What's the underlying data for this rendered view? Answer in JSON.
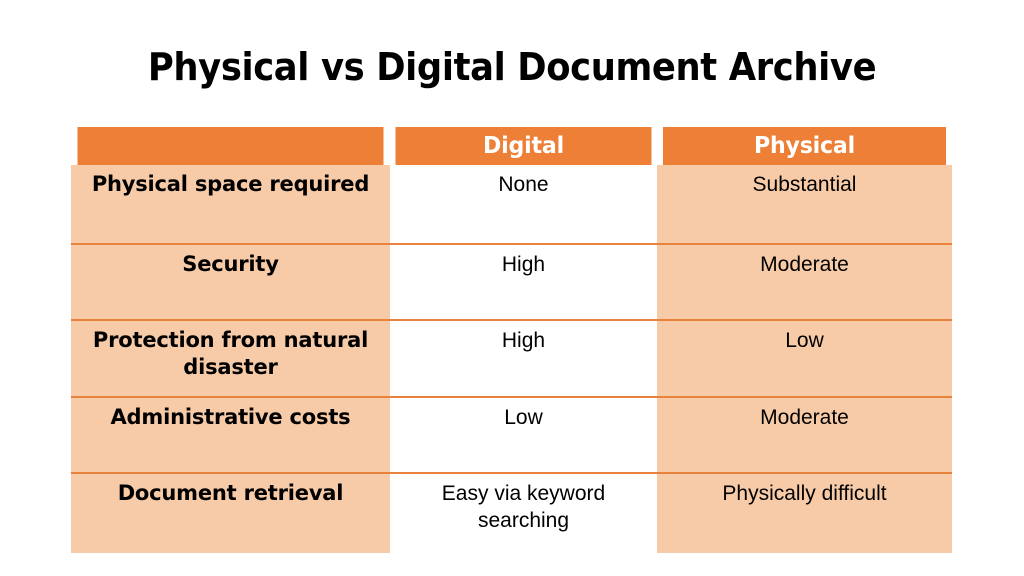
{
  "title": "Physical vs Digital Document Archive",
  "colors": {
    "header_orange": "#ED8036",
    "cell_peach": "#F8CBA8",
    "cell_white": "#FFFFFF",
    "row_divider": "#E8823C",
    "header_text": "#FFFFFF",
    "body_text": "#000000",
    "background": "#FFFFFF"
  },
  "table": {
    "columns": [
      {
        "key": "criterion",
        "label": ""
      },
      {
        "key": "digital",
        "label": "Digital"
      },
      {
        "key": "physical",
        "label": "Physical"
      }
    ],
    "rows": [
      {
        "criterion": "Physical space required",
        "digital": "None",
        "physical": "Substantial"
      },
      {
        "criterion": "Security",
        "digital": "High",
        "physical": "Moderate"
      },
      {
        "criterion": "Protection from natural disaster",
        "digital": "High",
        "physical": "Low"
      },
      {
        "criterion": "Administrative costs",
        "digital": "Low",
        "physical": "Moderate"
      },
      {
        "criterion": "Document retrieval",
        "digital": "Easy via keyword searching",
        "physical": "Physically difficult"
      }
    ]
  }
}
